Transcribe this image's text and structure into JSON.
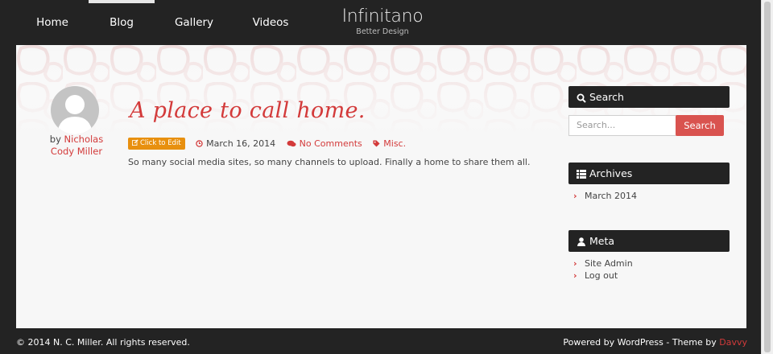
{
  "nav": {
    "items": [
      {
        "label": "Home",
        "active": false
      },
      {
        "label": "Blog",
        "active": true
      },
      {
        "label": "Gallery",
        "active": false
      },
      {
        "label": "Videos",
        "active": false
      }
    ]
  },
  "brand": {
    "title": "Infinitano",
    "subtitle": "Better Design"
  },
  "post": {
    "author_prefix": "by",
    "author_line1": "Nicholas",
    "author_line2": "Cody Miller",
    "title": "A place to call home.",
    "edit_label": "Click to Edit",
    "date": "March 16, 2014",
    "comments": "No Comments",
    "category": "Misc.",
    "excerpt": "So many social media sites, so many channels to upload. Finally a home to share them all."
  },
  "sidebar": {
    "search": {
      "title": "Search",
      "placeholder": "Search...",
      "button": "Search"
    },
    "archives": {
      "title": "Archives",
      "items": [
        "March 2014"
      ]
    },
    "meta": {
      "title": "Meta",
      "items": [
        "Site Admin",
        "Log out"
      ]
    }
  },
  "footer": {
    "copyright": "© 2014 N. C. Miller. All rights reserved.",
    "powered": "Powered by WordPress - Theme by ",
    "theme_author": "Davvy"
  },
  "colors": {
    "accent": "#d33a3a",
    "dark": "#232323",
    "edit": "#e8900f",
    "search_button": "#d9534f"
  },
  "icons": [
    "search-icon",
    "grid-icon",
    "user-icon",
    "clock-icon",
    "comments-icon",
    "tag-icon",
    "edit-icon",
    "chevron-right-icon"
  ]
}
